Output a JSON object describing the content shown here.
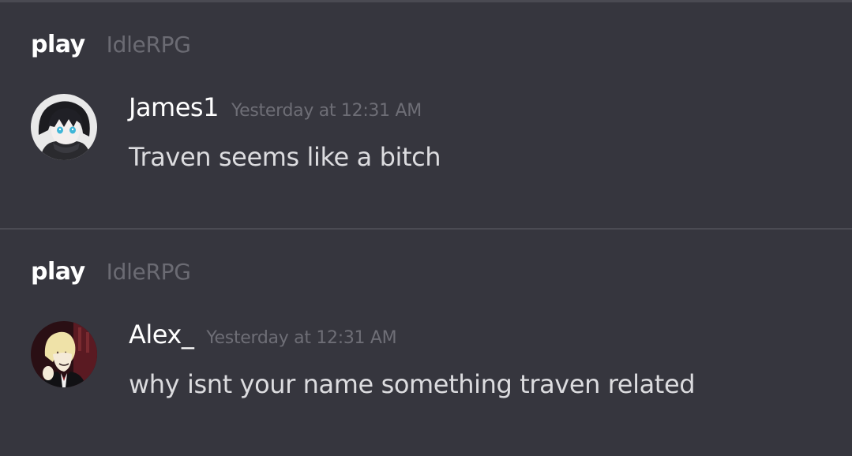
{
  "messages": [
    {
      "channel": "play",
      "server": "IdleRPG",
      "username": "James1",
      "timestamp": "Yesterday at 12:31 AM",
      "text": "Traven seems like a bitch",
      "avatar": "anime-boy-avatar"
    },
    {
      "channel": "play",
      "server": "IdleRPG",
      "username": "Alex_",
      "timestamp": "Yesterday at 12:31 AM",
      "text": "why isnt your name something traven related",
      "avatar": "anime-blonde-avatar"
    }
  ]
}
